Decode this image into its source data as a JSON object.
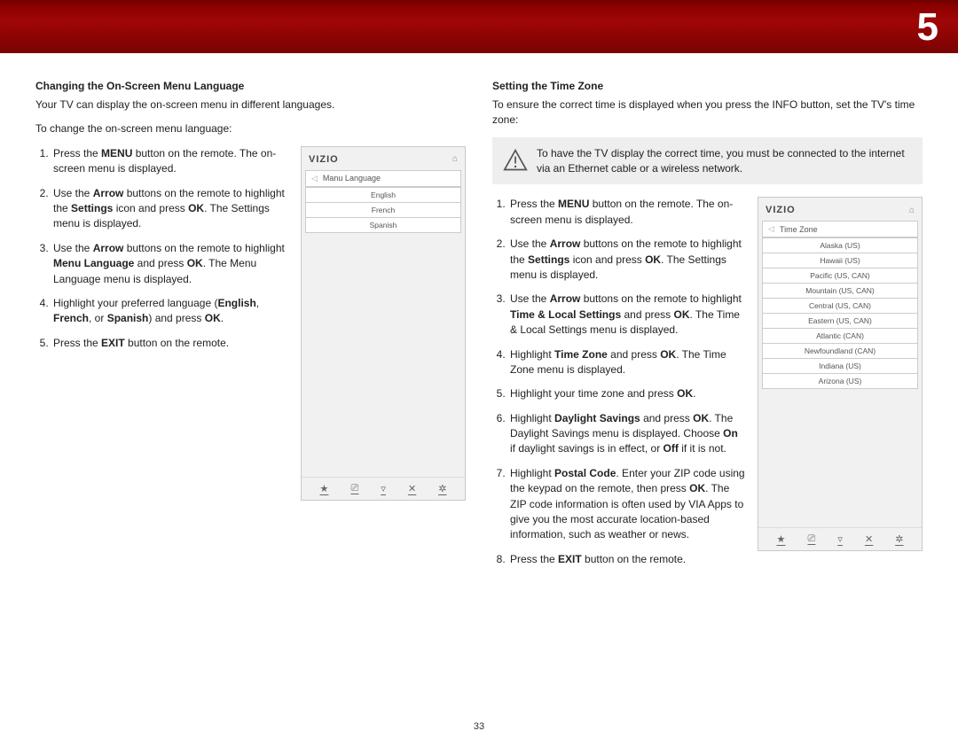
{
  "chapter_number": "5",
  "page_number": "33",
  "left": {
    "heading": "Changing the On-Screen Menu Language",
    "intro": "Your TV can display the on-screen menu in different languages.",
    "lead": "To change the on-screen menu language:",
    "steps": [
      "Press the <b>MENU</b> button on the remote. The on-screen menu is displayed.",
      "Use the <b>Arrow</b> buttons on the remote to highlight the <b>Settings</b> icon and press <b>OK</b>. The Settings menu is displayed.",
      "Use the <b>Arrow</b> buttons on the remote to highlight <b>Menu Language</b> and press <b>OK</b>. The Menu Language menu is displayed.",
      "Highlight your preferred language (<b>English</b>, <b>French</b>, or <b>Spanish</b>) and press <b>OK</b>.",
      "Press the <b>EXIT</b> button on the remote."
    ],
    "tv": {
      "brand": "VIZIO",
      "crumb": "Manu Language",
      "rows": [
        "English",
        "French",
        "Spanish"
      ],
      "foot": [
        "★",
        "⎚",
        "▿",
        "✕",
        "✲"
      ]
    }
  },
  "right": {
    "heading": "Setting the Time Zone",
    "intro": "To ensure the correct time is displayed when you press the INFO button, set the TV's time zone:",
    "callout": "To have the TV display the correct time, you must be connected to the internet via an Ethernet cable or a wireless network.",
    "steps": [
      "Press the <b>MENU</b> button on the remote. The on-screen menu is displayed.",
      "Use the <b>Arrow</b> buttons on the remote to highlight the <b>Settings</b> icon and press <b>OK</b>. The Settings menu is displayed.",
      "Use the <b>Arrow</b> buttons on the remote to highlight <b>Time & Local Settings</b> and press <b>OK</b>. The Time & Local Settings menu is displayed.",
      "Highlight <b>Time Zone</b> and press <b>OK</b>. The Time Zone menu is displayed.",
      "Highlight your time zone and press <b>OK</b>.",
      "Highlight <b>Daylight Savings</b> and press <b>OK</b>. The Daylight Savings menu is displayed. Choose <b>On</b> if daylight savings is in effect, or <b>Off</b> if it is not.",
      "Highlight <b>Postal Code</b>. Enter your ZIP code using the keypad on the remote, then press <b>OK</b>. The ZIP code information is often used by VIA Apps to give you the most accurate location-based information, such as weather or news.",
      "Press the <b>EXIT</b> button on the remote."
    ],
    "tv": {
      "brand": "VIZIO",
      "crumb": "Time Zone",
      "rows": [
        "Alaska (US)",
        "Hawaii (US)",
        "Pacific (US, CAN)",
        "Mountain (US, CAN)",
        "Central (US, CAN)",
        "Eastern (US, CAN)",
        "Atlantic (CAN)",
        "Newfoundland (CAN)",
        "Indiana (US)",
        "Arizona (US)"
      ],
      "foot": [
        "★",
        "⎚",
        "▿",
        "✕",
        "✲"
      ]
    }
  }
}
